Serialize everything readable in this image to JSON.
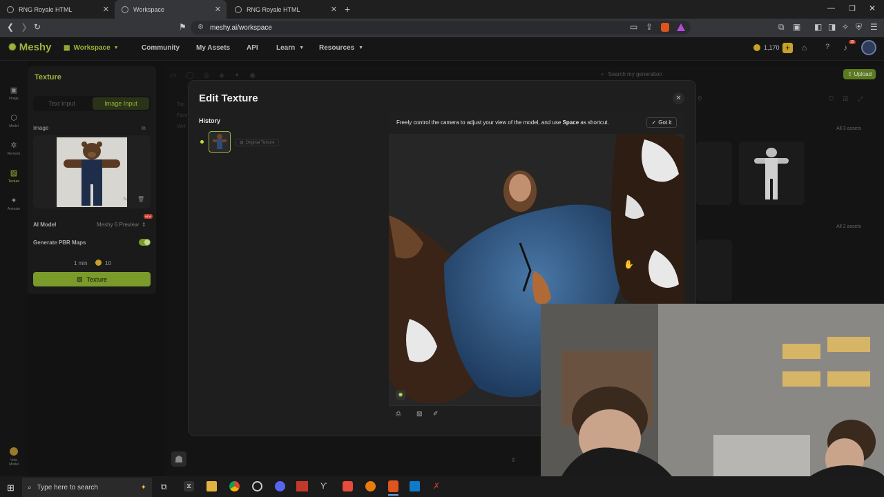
{
  "browser": {
    "tabs": [
      {
        "label": "RNG Royale HTML",
        "active": false
      },
      {
        "label": "Workspace",
        "active": true
      },
      {
        "label": "RNG Royale HTML",
        "active": false
      }
    ],
    "url": "meshy.ai/workspace"
  },
  "app": {
    "logo": "Meshy",
    "nav": [
      "Workspace",
      "Community",
      "My Assets",
      "API",
      "Learn",
      "Resources"
    ],
    "credits": "1,170",
    "notif_badge": "19",
    "search_placeholder": "Search my generation",
    "upload_label": "Upload",
    "all_assets_1": "All 3 assets",
    "all_assets_2": "All 2 assets"
  },
  "sidebar_strip": [
    {
      "icon": "image-icon",
      "label": "Image"
    },
    {
      "icon": "model-icon",
      "label": "Model"
    },
    {
      "icon": "remesh-icon",
      "label": "Remesh"
    },
    {
      "icon": "texture-icon",
      "label": "Texture"
    },
    {
      "icon": "animate-icon",
      "label": "Animate"
    }
  ],
  "vote_label_1": "Vote",
  "vote_label_2": "Model",
  "left_panel": {
    "title": "Texture",
    "tab_text": "Text Input",
    "tab_image": "Image Input",
    "image_label": "Image",
    "ai_model_label": "AI Model",
    "ai_model_value": "Meshy 6 Preview",
    "new_badge": "NEW",
    "pbr_label": "Generate PBR Maps",
    "time": "1 min",
    "cost": "10",
    "texture_button": "Texture"
  },
  "bg_fragments": [
    "Top",
    "Face",
    "Vert"
  ],
  "modal": {
    "title": "Edit Texture",
    "history_label": "History",
    "original_texture": "Original Texture",
    "tip_text_1": "Freely control the camera to adjust your view of the model, and use ",
    "tip_bold": "Space",
    "tip_text_2": " as shortcut.",
    "got_it": "Got it"
  },
  "taskbar": {
    "search_placeholder": "Type here to search"
  },
  "colors": {
    "accent_green": "#9ab53a",
    "button_green": "#7a9a2a"
  }
}
